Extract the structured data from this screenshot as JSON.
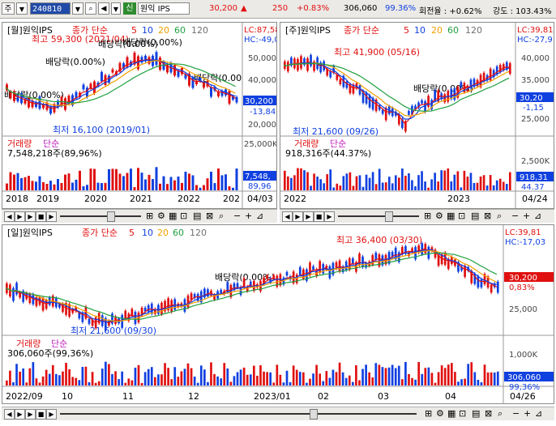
{
  "toolbar": {
    "market": "주",
    "code": "240810",
    "sin_label": "신",
    "stock_name": "원익 IPS",
    "price": "30,200",
    "change_arrow": "▲",
    "change": "250",
    "change_pct": "+0.83%",
    "volume": "306,060",
    "volume_ratio": "99.36%",
    "turnover": "회전율 : +0.62%",
    "strength": "강도 : 103.43%"
  },
  "panes": {
    "monthly": {
      "title": "[월]원익IPS",
      "ma_label": "종가 단순",
      "ma_periods": [
        "5",
        "10",
        "20",
        "60",
        "120"
      ],
      "lc": "LC:87,58",
      "hc": "HC:-49,0",
      "high_note": "최고 59,300 (2021/04)",
      "low_note": "최저 16,100 (2019/01)",
      "div_notes": [
        "배당락(0.00%)",
        "배당락(0.00%)",
        "배당락(0.00%)",
        "배당락(0.00%)",
        "배당락(0.00"
      ],
      "price_ticks": [
        "50,000",
        "40,000",
        "30,000",
        "20,000"
      ],
      "cur_price": "30,200",
      "cur_pct": "-13,84",
      "vol_label": "거래량",
      "vol_ma": "단순",
      "vol_value": "7,548,218주(89,96%)",
      "vol_tick": "25,000K",
      "vol_cur": "7,548,",
      "vol_pct": "89,96",
      "x_labels": [
        "2018",
        "2019",
        "2020",
        "2021",
        "2022",
        "202"
      ],
      "date": "04/03"
    },
    "weekly": {
      "title": "[주]원익IPS",
      "ma_label": "종가 단순",
      "ma_periods": [
        "5",
        "10",
        "20",
        "60",
        "120"
      ],
      "lc": "LC:39,81",
      "hc": "HC:-27,9",
      "high_note": "최고 41,900 (05/16)",
      "low_note": "최저 21,600 (09/26)",
      "div_note": "배당락(0.00%)",
      "price_ticks": [
        "40,000",
        "35,000",
        "25,000"
      ],
      "cur_price": "30,20",
      "cur_pct": "-1,15",
      "vol_label": "거래량",
      "vol_ma": "단순",
      "vol_value": "918,316주(44.37%)",
      "vol_tick": "2,500K",
      "vol_cur": "918,31",
      "vol_pct": "44.37",
      "x_labels": [
        "2022",
        "2023"
      ],
      "date": "04/24"
    },
    "daily": {
      "title": "[일]원익IPS",
      "ma_label": "종가 단순",
      "ma_periods": [
        "5",
        "10",
        "20",
        "60",
        "120"
      ],
      "lc": "LC:39,81",
      "hc": "HC:-17,03",
      "high_note": "최고 36,400 (03/30)",
      "low_note": "최저 21,600 (09/30)",
      "div_note": "배당락(0.00%)",
      "price_ticks": [
        "25,000"
      ],
      "cur_price": "30,200",
      "cur_pct": "0,83%",
      "vol_label": "거래량",
      "vol_ma": "단순",
      "vol_value": "306,060주(99,36%)",
      "vol_tick": "1,000K",
      "vol_cur": "306,060",
      "vol_pct": "99,36%",
      "x_labels": [
        "2022/09",
        "10",
        "11",
        "12",
        "2023/01",
        "02",
        "03",
        "04"
      ],
      "date": "04/26"
    }
  },
  "colors": {
    "up": "#e01010",
    "down": "#1040e0",
    "ma5": "#e01010",
    "ma10": "#1040e0",
    "ma20": "#f0a000",
    "ma60": "#20a040",
    "ma120": "#707070",
    "vol": "#c020c0"
  }
}
